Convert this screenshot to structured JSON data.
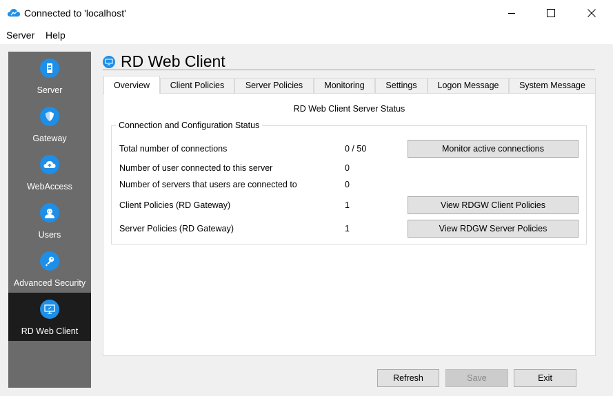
{
  "window": {
    "title": "Connected to 'localhost'",
    "controls": {
      "minimize": "minimize-icon",
      "maximize": "maximize-icon",
      "close": "close-icon"
    }
  },
  "menu": [
    "Server",
    "Help"
  ],
  "sidebar": {
    "items": [
      {
        "label": "Server",
        "icon": "server-icon",
        "active": false
      },
      {
        "label": "Gateway",
        "icon": "shield-icon",
        "active": false
      },
      {
        "label": "WebAccess",
        "icon": "cloud-icon",
        "active": false
      },
      {
        "label": "Users",
        "icon": "users-icon",
        "active": false
      },
      {
        "label": "Advanced Security",
        "icon": "key-icon",
        "active": false
      },
      {
        "label": "RD Web Client",
        "icon": "monitor-icon",
        "active": true
      }
    ]
  },
  "page": {
    "title": "RD Web Client"
  },
  "tabs": [
    {
      "label": "Overview",
      "selected": true
    },
    {
      "label": "Client Policies",
      "selected": false
    },
    {
      "label": "Server Policies",
      "selected": false
    },
    {
      "label": "Monitoring",
      "selected": false
    },
    {
      "label": "Settings",
      "selected": false
    },
    {
      "label": "Logon Message",
      "selected": false
    },
    {
      "label": "System Message",
      "selected": false
    }
  ],
  "overview": {
    "heading": "RD Web Client Server Status",
    "group_title": "Connection  and Configuration Status",
    "rows": [
      {
        "label": "Total number of connections",
        "value": "0 / 50",
        "button": "Monitor active connections"
      },
      {
        "label": "Number of user connected to this server",
        "value": "0"
      },
      {
        "label": "Number of servers that users are connected to",
        "value": "0"
      },
      {
        "label": "Client Policies (RD Gateway)",
        "value": "1",
        "button": "View RDGW Client Policies"
      },
      {
        "label": "Server Policies (RD Gateway)",
        "value": "1",
        "button": "View RDGW Server Policies"
      }
    ]
  },
  "footer": {
    "refresh": "Refresh",
    "save": "Save",
    "save_enabled": false,
    "exit": "Exit"
  },
  "colors": {
    "accent": "#1e8fe8",
    "sidebar_bg": "#6b6b6b",
    "sidebar_active": "#1c1c1c"
  }
}
